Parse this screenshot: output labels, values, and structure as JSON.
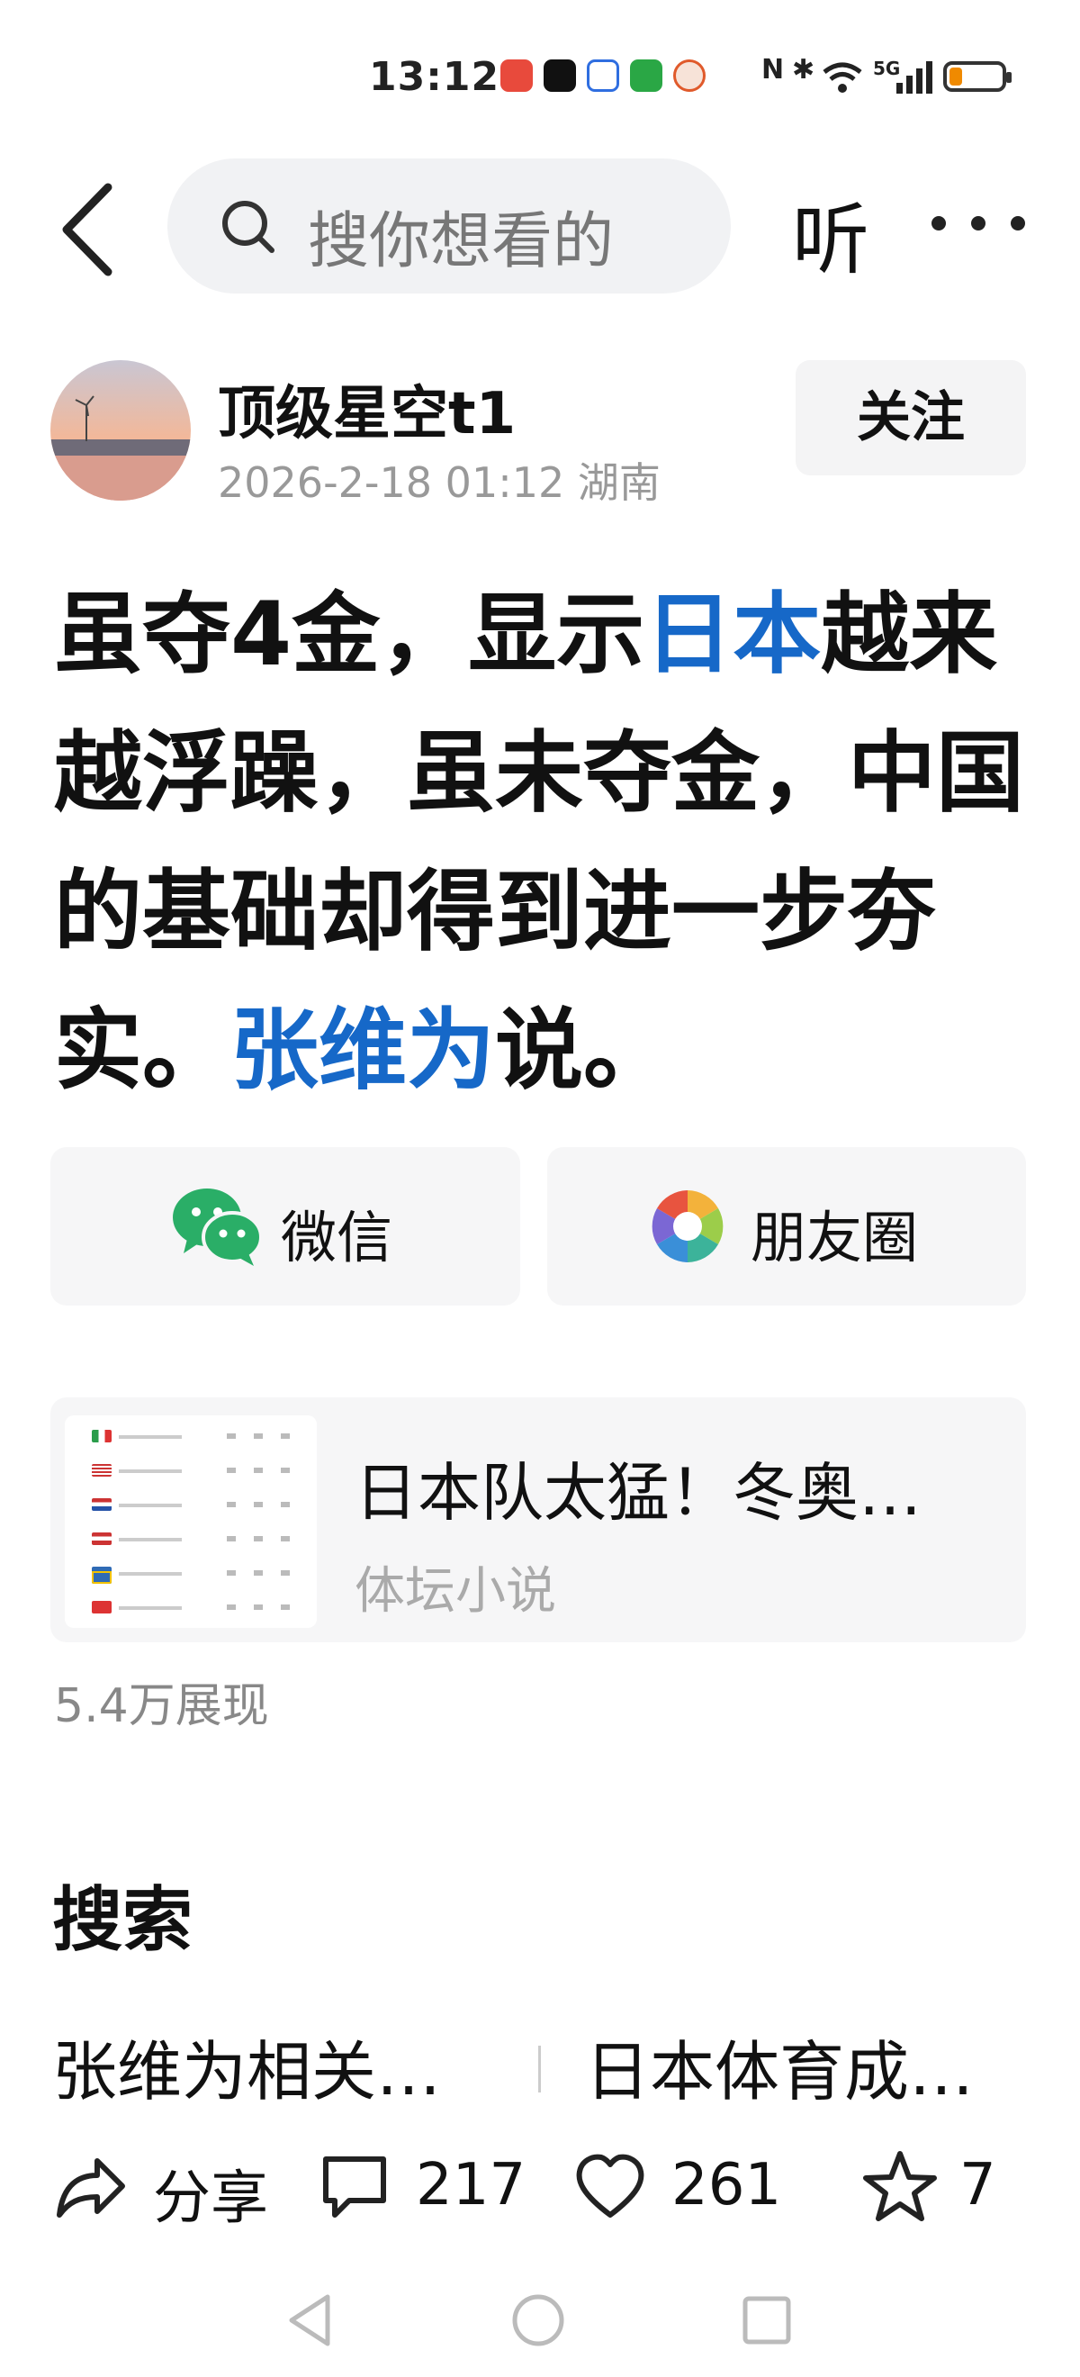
{
  "status_bar": {
    "time": "13:12",
    "network": "5G",
    "battery_level": 0.2
  },
  "header": {
    "search_placeholder": "搜你想看的",
    "listen_label": "听"
  },
  "author": {
    "name": "顶级星空t1",
    "date": "2026-2-18 01:12",
    "location": "湖南",
    "follow_label": "关注"
  },
  "article": {
    "title_parts": [
      {
        "text": "虽夺4金，显示",
        "keyword": false
      },
      {
        "text": "日本",
        "keyword": true
      },
      {
        "text": "越来越浮躁，虽未夺金，中国的基础却得到进一步夯实。",
        "keyword": false
      },
      {
        "text": "张维为",
        "keyword": true
      },
      {
        "text": "说。",
        "keyword": false
      }
    ]
  },
  "share": {
    "wechat_label": "微信",
    "moments_label": "朋友圈"
  },
  "related": {
    "title": "日本队太猛！冬奥…",
    "source": "体坛小说"
  },
  "views": "5.4万展现",
  "search_section": {
    "heading": "搜索",
    "items": [
      "张维为相关…",
      "日本体育成…"
    ]
  },
  "actions": {
    "share_label": "分享",
    "comments": "217",
    "likes": "261",
    "favorites": "7"
  },
  "colors": {
    "keyword": "#1668c8",
    "wechat": "#2aae67",
    "battery": "#f08a00"
  }
}
